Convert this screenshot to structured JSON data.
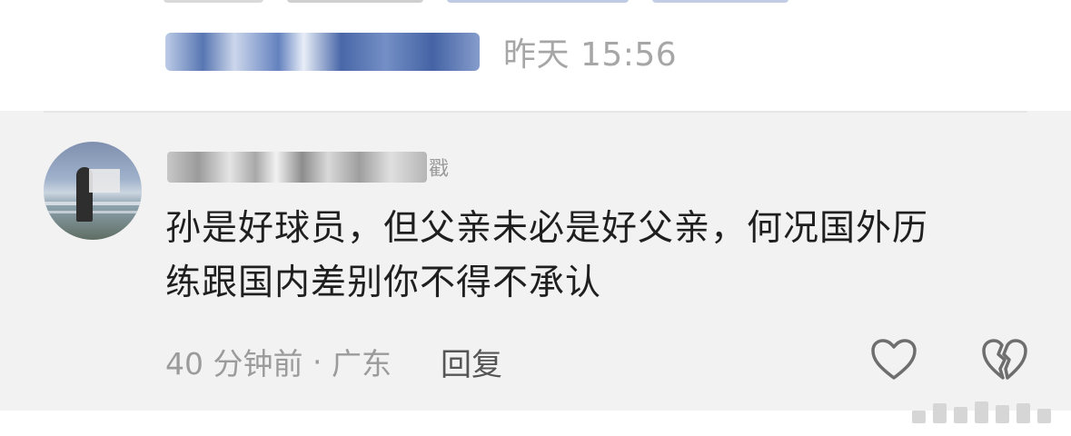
{
  "previous_comment": {
    "timestamp": "昨天 15:56"
  },
  "comment": {
    "username_suffix": "戳",
    "text_lines": [
      "孙是好球员，但父亲未必是好父亲，何况国外历",
      "练跟国内差别你不得不承认"
    ],
    "time_ago": "40 分钟前",
    "separator": " · ",
    "location": "广东",
    "reply_label": "回复",
    "icons": {
      "avatar": "user-avatar",
      "like": "heart-outline-icon",
      "dislike": "broken-heart-icon"
    }
  },
  "colors": {
    "comment_background": "#f2f2f2",
    "link_blue": "#3f5fa3",
    "meta_gray": "#9b9b9b",
    "text_dark": "#1f1f1f"
  }
}
